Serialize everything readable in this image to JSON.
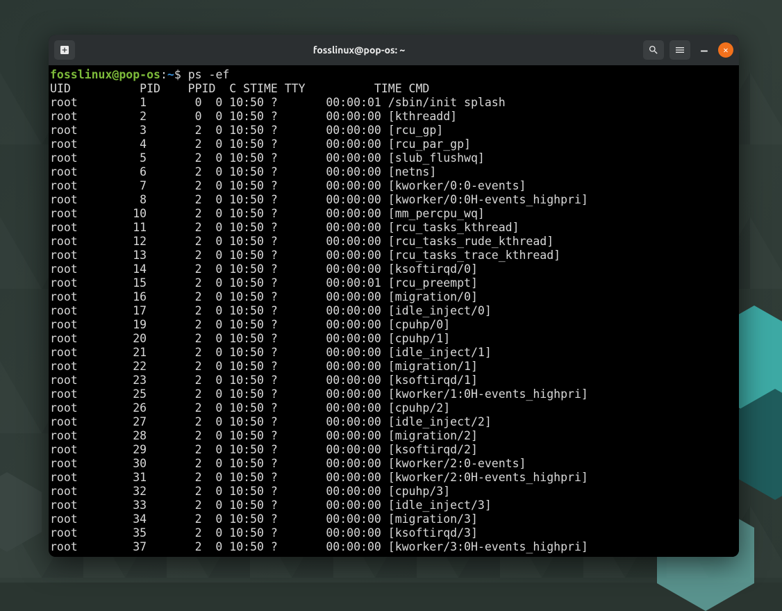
{
  "window": {
    "title": "fosslinux@pop-os: ~"
  },
  "prompt": {
    "user_host": "fosslinux@pop-os",
    "separator": ":",
    "path": "~",
    "symbol": "$",
    "command": "ps -ef"
  },
  "header": "UID          PID    PPID  C STIME TTY          TIME CMD",
  "processes": [
    {
      "uid": "root",
      "pid": 1,
      "ppid": 0,
      "c": 0,
      "stime": "10:50",
      "tty": "?",
      "time": "00:00:01",
      "cmd": "/sbin/init splash"
    },
    {
      "uid": "root",
      "pid": 2,
      "ppid": 0,
      "c": 0,
      "stime": "10:50",
      "tty": "?",
      "time": "00:00:00",
      "cmd": "[kthreadd]"
    },
    {
      "uid": "root",
      "pid": 3,
      "ppid": 2,
      "c": 0,
      "stime": "10:50",
      "tty": "?",
      "time": "00:00:00",
      "cmd": "[rcu_gp]"
    },
    {
      "uid": "root",
      "pid": 4,
      "ppid": 2,
      "c": 0,
      "stime": "10:50",
      "tty": "?",
      "time": "00:00:00",
      "cmd": "[rcu_par_gp]"
    },
    {
      "uid": "root",
      "pid": 5,
      "ppid": 2,
      "c": 0,
      "stime": "10:50",
      "tty": "?",
      "time": "00:00:00",
      "cmd": "[slub_flushwq]"
    },
    {
      "uid": "root",
      "pid": 6,
      "ppid": 2,
      "c": 0,
      "stime": "10:50",
      "tty": "?",
      "time": "00:00:00",
      "cmd": "[netns]"
    },
    {
      "uid": "root",
      "pid": 7,
      "ppid": 2,
      "c": 0,
      "stime": "10:50",
      "tty": "?",
      "time": "00:00:00",
      "cmd": "[kworker/0:0-events]"
    },
    {
      "uid": "root",
      "pid": 8,
      "ppid": 2,
      "c": 0,
      "stime": "10:50",
      "tty": "?",
      "time": "00:00:00",
      "cmd": "[kworker/0:0H-events_highpri]"
    },
    {
      "uid": "root",
      "pid": 10,
      "ppid": 2,
      "c": 0,
      "stime": "10:50",
      "tty": "?",
      "time": "00:00:00",
      "cmd": "[mm_percpu_wq]"
    },
    {
      "uid": "root",
      "pid": 11,
      "ppid": 2,
      "c": 0,
      "stime": "10:50",
      "tty": "?",
      "time": "00:00:00",
      "cmd": "[rcu_tasks_kthread]"
    },
    {
      "uid": "root",
      "pid": 12,
      "ppid": 2,
      "c": 0,
      "stime": "10:50",
      "tty": "?",
      "time": "00:00:00",
      "cmd": "[rcu_tasks_rude_kthread]"
    },
    {
      "uid": "root",
      "pid": 13,
      "ppid": 2,
      "c": 0,
      "stime": "10:50",
      "tty": "?",
      "time": "00:00:00",
      "cmd": "[rcu_tasks_trace_kthread]"
    },
    {
      "uid": "root",
      "pid": 14,
      "ppid": 2,
      "c": 0,
      "stime": "10:50",
      "tty": "?",
      "time": "00:00:00",
      "cmd": "[ksoftirqd/0]"
    },
    {
      "uid": "root",
      "pid": 15,
      "ppid": 2,
      "c": 0,
      "stime": "10:50",
      "tty": "?",
      "time": "00:00:01",
      "cmd": "[rcu_preempt]"
    },
    {
      "uid": "root",
      "pid": 16,
      "ppid": 2,
      "c": 0,
      "stime": "10:50",
      "tty": "?",
      "time": "00:00:00",
      "cmd": "[migration/0]"
    },
    {
      "uid": "root",
      "pid": 17,
      "ppid": 2,
      "c": 0,
      "stime": "10:50",
      "tty": "?",
      "time": "00:00:00",
      "cmd": "[idle_inject/0]"
    },
    {
      "uid": "root",
      "pid": 19,
      "ppid": 2,
      "c": 0,
      "stime": "10:50",
      "tty": "?",
      "time": "00:00:00",
      "cmd": "[cpuhp/0]"
    },
    {
      "uid": "root",
      "pid": 20,
      "ppid": 2,
      "c": 0,
      "stime": "10:50",
      "tty": "?",
      "time": "00:00:00",
      "cmd": "[cpuhp/1]"
    },
    {
      "uid": "root",
      "pid": 21,
      "ppid": 2,
      "c": 0,
      "stime": "10:50",
      "tty": "?",
      "time": "00:00:00",
      "cmd": "[idle_inject/1]"
    },
    {
      "uid": "root",
      "pid": 22,
      "ppid": 2,
      "c": 0,
      "stime": "10:50",
      "tty": "?",
      "time": "00:00:00",
      "cmd": "[migration/1]"
    },
    {
      "uid": "root",
      "pid": 23,
      "ppid": 2,
      "c": 0,
      "stime": "10:50",
      "tty": "?",
      "time": "00:00:00",
      "cmd": "[ksoftirqd/1]"
    },
    {
      "uid": "root",
      "pid": 25,
      "ppid": 2,
      "c": 0,
      "stime": "10:50",
      "tty": "?",
      "time": "00:00:00",
      "cmd": "[kworker/1:0H-events_highpri]"
    },
    {
      "uid": "root",
      "pid": 26,
      "ppid": 2,
      "c": 0,
      "stime": "10:50",
      "tty": "?",
      "time": "00:00:00",
      "cmd": "[cpuhp/2]"
    },
    {
      "uid": "root",
      "pid": 27,
      "ppid": 2,
      "c": 0,
      "stime": "10:50",
      "tty": "?",
      "time": "00:00:00",
      "cmd": "[idle_inject/2]"
    },
    {
      "uid": "root",
      "pid": 28,
      "ppid": 2,
      "c": 0,
      "stime": "10:50",
      "tty": "?",
      "time": "00:00:00",
      "cmd": "[migration/2]"
    },
    {
      "uid": "root",
      "pid": 29,
      "ppid": 2,
      "c": 0,
      "stime": "10:50",
      "tty": "?",
      "time": "00:00:00",
      "cmd": "[ksoftirqd/2]"
    },
    {
      "uid": "root",
      "pid": 30,
      "ppid": 2,
      "c": 0,
      "stime": "10:50",
      "tty": "?",
      "time": "00:00:00",
      "cmd": "[kworker/2:0-events]"
    },
    {
      "uid": "root",
      "pid": 31,
      "ppid": 2,
      "c": 0,
      "stime": "10:50",
      "tty": "?",
      "time": "00:00:00",
      "cmd": "[kworker/2:0H-events_highpri]"
    },
    {
      "uid": "root",
      "pid": 32,
      "ppid": 2,
      "c": 0,
      "stime": "10:50",
      "tty": "?",
      "time": "00:00:00",
      "cmd": "[cpuhp/3]"
    },
    {
      "uid": "root",
      "pid": 33,
      "ppid": 2,
      "c": 0,
      "stime": "10:50",
      "tty": "?",
      "time": "00:00:00",
      "cmd": "[idle_inject/3]"
    },
    {
      "uid": "root",
      "pid": 34,
      "ppid": 2,
      "c": 0,
      "stime": "10:50",
      "tty": "?",
      "time": "00:00:00",
      "cmd": "[migration/3]"
    },
    {
      "uid": "root",
      "pid": 35,
      "ppid": 2,
      "c": 0,
      "stime": "10:50",
      "tty": "?",
      "time": "00:00:00",
      "cmd": "[ksoftirqd/3]"
    },
    {
      "uid": "root",
      "pid": 37,
      "ppid": 2,
      "c": 0,
      "stime": "10:50",
      "tty": "?",
      "time": "00:00:00",
      "cmd": "[kworker/3:0H-events_highpri]"
    }
  ]
}
